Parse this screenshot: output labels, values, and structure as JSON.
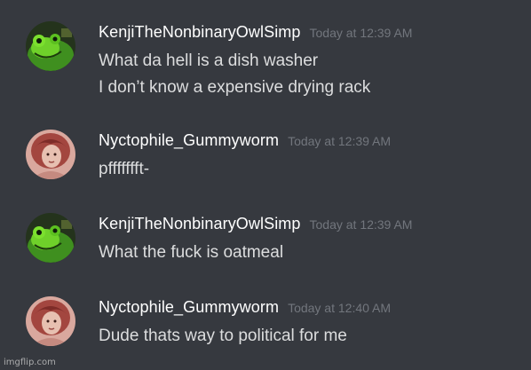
{
  "messages": [
    {
      "author": "KenjiTheNonbinaryOwlSimp",
      "timestamp": "Today at 12:39 AM",
      "avatar": "green-frog-avatar",
      "lines": [
        "What da hell is a dish washer",
        "I don’t know a expensive drying rack"
      ]
    },
    {
      "author": "Nyctophile_Gummyworm",
      "timestamp": "Today at 12:39 AM",
      "avatar": "red-haired-portrait-avatar",
      "lines": [
        "pffffffft-"
      ]
    },
    {
      "author": "KenjiTheNonbinaryOwlSimp",
      "timestamp": "Today at 12:39 AM",
      "avatar": "green-frog-avatar",
      "lines": [
        "What the fuck is oatmeal"
      ]
    },
    {
      "author": "Nyctophile_Gummyworm",
      "timestamp": "Today at 12:40 AM",
      "avatar": "red-haired-portrait-avatar",
      "lines": [
        "Dude thats way to political for me"
      ]
    }
  ],
  "watermark": "imgflip.com",
  "colors": {
    "background": "#36393f",
    "username": "#ffffff",
    "timestamp": "#72767d",
    "message_text": "#dcddde"
  }
}
